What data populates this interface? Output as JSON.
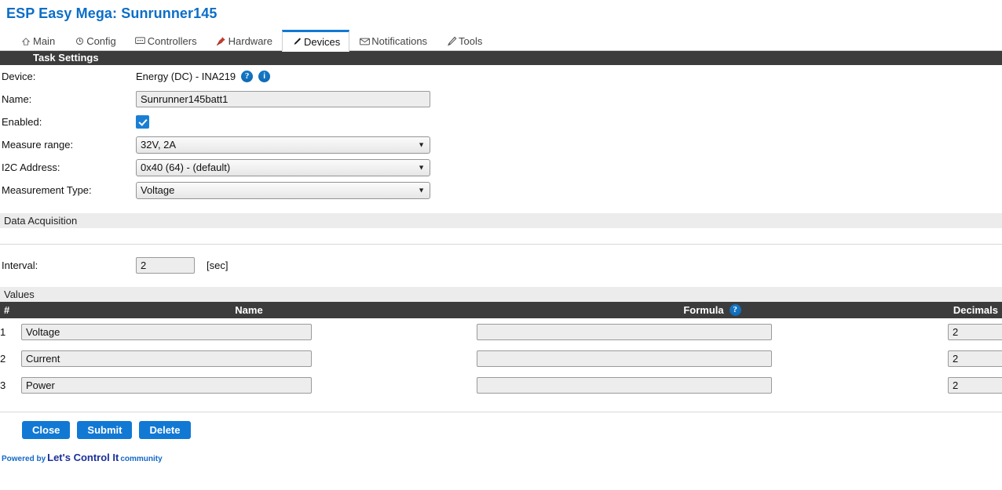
{
  "header": {
    "title": "ESP Easy Mega: Sunrunner145",
    "title_color": "#0b6ec7"
  },
  "tabs": [
    {
      "label": "Main",
      "icon": "home-icon",
      "glyph": "⌂",
      "active": false
    },
    {
      "label": "Config",
      "icon": "gear-icon",
      "glyph": "⊙",
      "active": false
    },
    {
      "label": "Controllers",
      "icon": "chat-box-icon",
      "glyph": "💬",
      "active": false
    },
    {
      "label": "Hardware",
      "icon": "pushpin-icon",
      "glyph": "📌",
      "active": false
    },
    {
      "label": "Devices",
      "icon": "pen-icon",
      "glyph": "✒",
      "active": true
    },
    {
      "label": "Notifications",
      "icon": "envelope-icon",
      "glyph": "✉",
      "active": false
    },
    {
      "label": "Tools",
      "icon": "wrench-pen-icon",
      "glyph": "🖊",
      "active": false
    }
  ],
  "task_settings": {
    "section_label": "Task Settings",
    "device": {
      "label": "Device:",
      "value": "Energy (DC) - INA219",
      "help_badge": "?",
      "info_badge": "i"
    },
    "name": {
      "label": "Name:",
      "value": "Sunrunner145batt1",
      "placeholder": ""
    },
    "enabled": {
      "label": "Enabled:",
      "checked": true
    },
    "measure_range": {
      "label": "Measure range:",
      "value": "32V, 2A"
    },
    "i2c_address": {
      "label": "I2C Address:",
      "value": "0x40 (64) - (default)"
    },
    "measurement_type": {
      "label": "Measurement Type:",
      "value": "Voltage"
    }
  },
  "data_acquisition": {
    "section_label": "Data Acquisition",
    "interval": {
      "label": "Interval:",
      "value": "2",
      "unit": "[sec]"
    }
  },
  "values": {
    "section_label": "Values",
    "columns": {
      "num": "#",
      "name": "Name",
      "formula": "Formula",
      "formula_help_badge": "?",
      "decimals": "Decimals"
    },
    "rows": [
      {
        "num": "1",
        "name": "Voltage",
        "formula": "",
        "decimals": "2"
      },
      {
        "num": "2",
        "name": "Current",
        "formula": "",
        "decimals": "2"
      },
      {
        "num": "3",
        "name": "Power",
        "formula": "",
        "decimals": "2"
      }
    ]
  },
  "buttons": {
    "close": "Close",
    "submit": "Submit",
    "delete": "Delete",
    "color": "#1179d4"
  },
  "footer": {
    "powered_by": "Powered by",
    "brand": "Let's Control It",
    "community": "community"
  }
}
